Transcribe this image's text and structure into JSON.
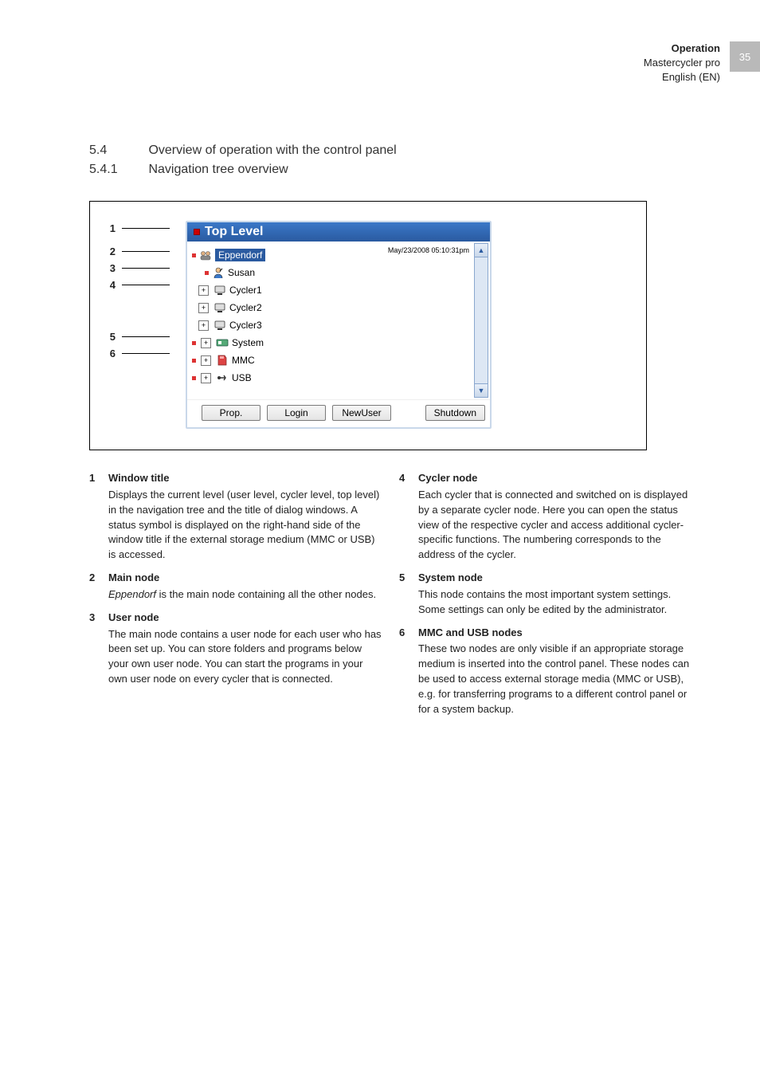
{
  "header": {
    "section": "Operation",
    "product": "Mastercycler pro",
    "lang": "English (EN)",
    "page_number": "35"
  },
  "headings": {
    "h1_num": "5.4",
    "h1_title": "Overview of operation with the control panel",
    "h2_num": "5.4.1",
    "h2_title": "Navigation tree overview"
  },
  "callouts": [
    "1",
    "2",
    "3",
    "4",
    "5",
    "6"
  ],
  "screenshot": {
    "title": "Top Level",
    "timestamp": "May/23/2008 05:10:31pm",
    "tree": {
      "root": "Eppendorf",
      "user": "Susan",
      "cyclers": [
        "Cycler1",
        "Cycler2",
        "Cycler3"
      ],
      "system": "System",
      "mmc": "MMC",
      "usb": "USB"
    },
    "buttons": {
      "prop": "Prop.",
      "login": "Login",
      "newuser": "NewUser",
      "shutdown": "Shutdown"
    },
    "scroll_up": "▲",
    "scroll_down": "▼"
  },
  "descriptions": {
    "left": [
      {
        "n": "1",
        "title": "Window title",
        "body": "Displays the current level (user level, cycler level, top level) in the navigation tree and the title of dialog windows. A status symbol is displayed on the right-hand side of the window title if the external storage medium (MMC or USB) is accessed."
      },
      {
        "n": "2",
        "title": "Main node",
        "body_html": "<i>Eppendorf</i> is the main node containing all the other nodes."
      },
      {
        "n": "3",
        "title": "User node",
        "body": "The main node contains a user node for each user who has been set up. You can store folders and programs below your own user node. You can start the programs in your own user node on every cycler that is connected."
      }
    ],
    "right": [
      {
        "n": "4",
        "title": "Cycler node",
        "body": "Each cycler that is connected and switched on is displayed by a separate cycler node. Here you can open the status view of the respective cycler and access additional cycler-specific functions. The numbering corresponds to the address of the cycler."
      },
      {
        "n": "5",
        "title": "System node",
        "body": "This node contains the most important system settings. Some settings can only be edited by the administrator."
      },
      {
        "n": "6",
        "title": "MMC and USB nodes",
        "body": "These two nodes are only visible if an appropriate storage medium is inserted into the control panel. These nodes can be used to access external storage media (MMC or USB), e.g. for transferring programs to a different control panel or for a system backup."
      }
    ]
  }
}
